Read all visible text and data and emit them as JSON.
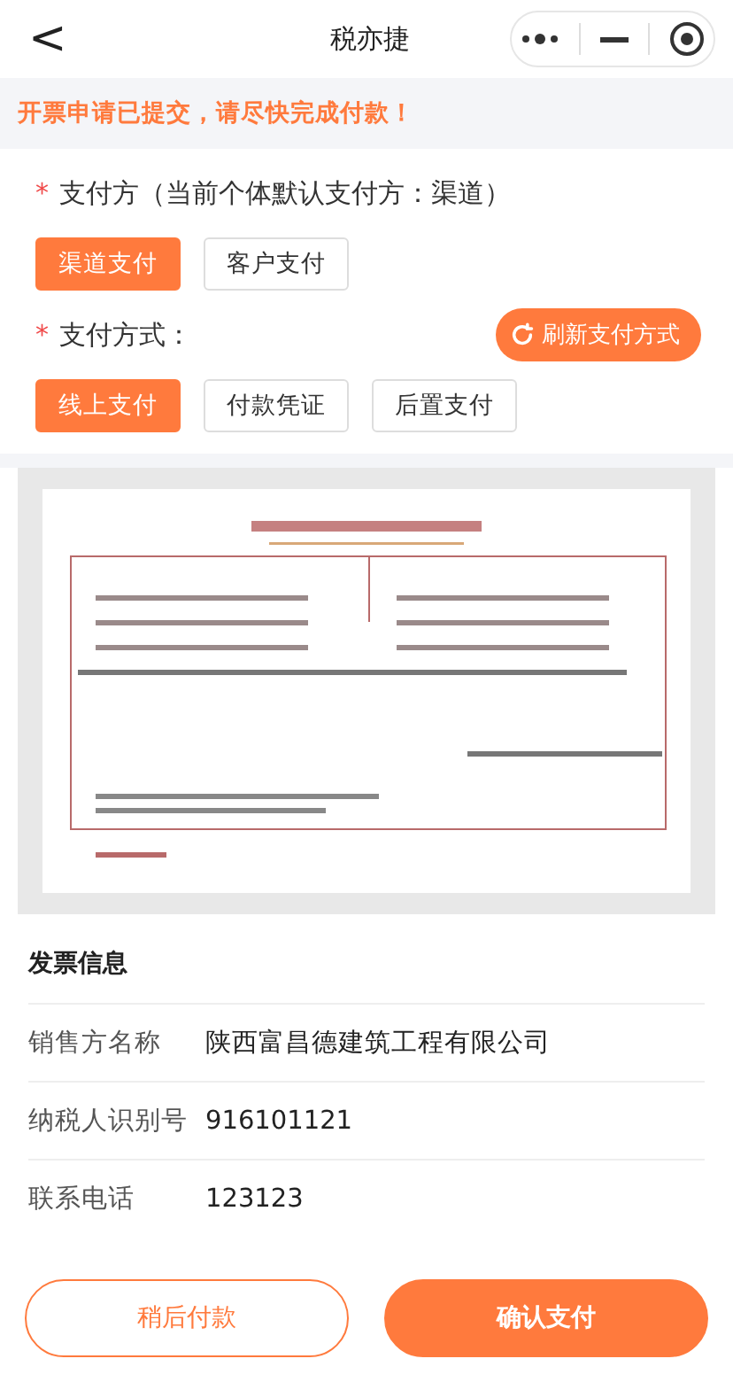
{
  "nav": {
    "back": "<",
    "title": "税亦捷"
  },
  "notice": "开票申请已提交，请尽快完成付款！",
  "payer": {
    "required": "*",
    "label": "支付方（当前个体默认支付方：渠道）",
    "options": [
      {
        "label": "渠道支付",
        "selected": true
      },
      {
        "label": "客户支付",
        "selected": false
      }
    ]
  },
  "method": {
    "required": "*",
    "label": "支付方式：",
    "refresh": "刷新支付方式",
    "options": [
      {
        "label": "线上支付",
        "selected": true
      },
      {
        "label": "付款凭证",
        "selected": false
      },
      {
        "label": "后置支付",
        "selected": false
      }
    ]
  },
  "info": {
    "title": "发票信息",
    "rows": [
      {
        "label": "销售方名称",
        "value": "陕西富昌德建筑工程有限公司"
      },
      {
        "label": "纳税人识别号",
        "value": "916101121"
      },
      {
        "label": "联系电话",
        "value": "123123"
      }
    ]
  },
  "buttons": {
    "later": "稍后付款",
    "confirm": "确认支付"
  }
}
